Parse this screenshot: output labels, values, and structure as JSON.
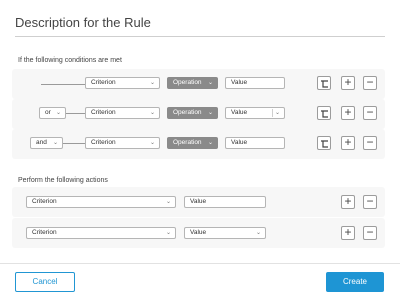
{
  "title": "Description for the Rule",
  "conditions": {
    "heading": "If the following conditions are met",
    "rows": [
      {
        "connector": null,
        "criterion": "Criterion",
        "operation": "Operation",
        "value": "Value",
        "value_has_dropdown": false
      },
      {
        "connector": "or",
        "criterion": "Criterion",
        "operation": "Operation",
        "value": "Value",
        "value_has_dropdown": true
      },
      {
        "connector": "and",
        "criterion": "Criterion",
        "operation": "Operation",
        "value": "Value",
        "value_has_dropdown": false
      }
    ]
  },
  "actions": {
    "heading": "Perform the following actions",
    "rows": [
      {
        "criterion": "Criterion",
        "value": "Value",
        "value_has_dropdown": false
      },
      {
        "criterion": "Criterion",
        "value": "Value",
        "value_has_dropdown": true
      }
    ]
  },
  "footer": {
    "cancel_label": "Cancel",
    "create_label": "Create"
  },
  "icons": {
    "add": "plus-icon",
    "remove": "minus-icon",
    "branch": "branch-icon",
    "dropdown": "chevron-down-icon"
  },
  "colors": {
    "accent": "#1e95d4",
    "operation_bg": "#8a8a8a",
    "panel_bg": "#f7f7f7"
  }
}
